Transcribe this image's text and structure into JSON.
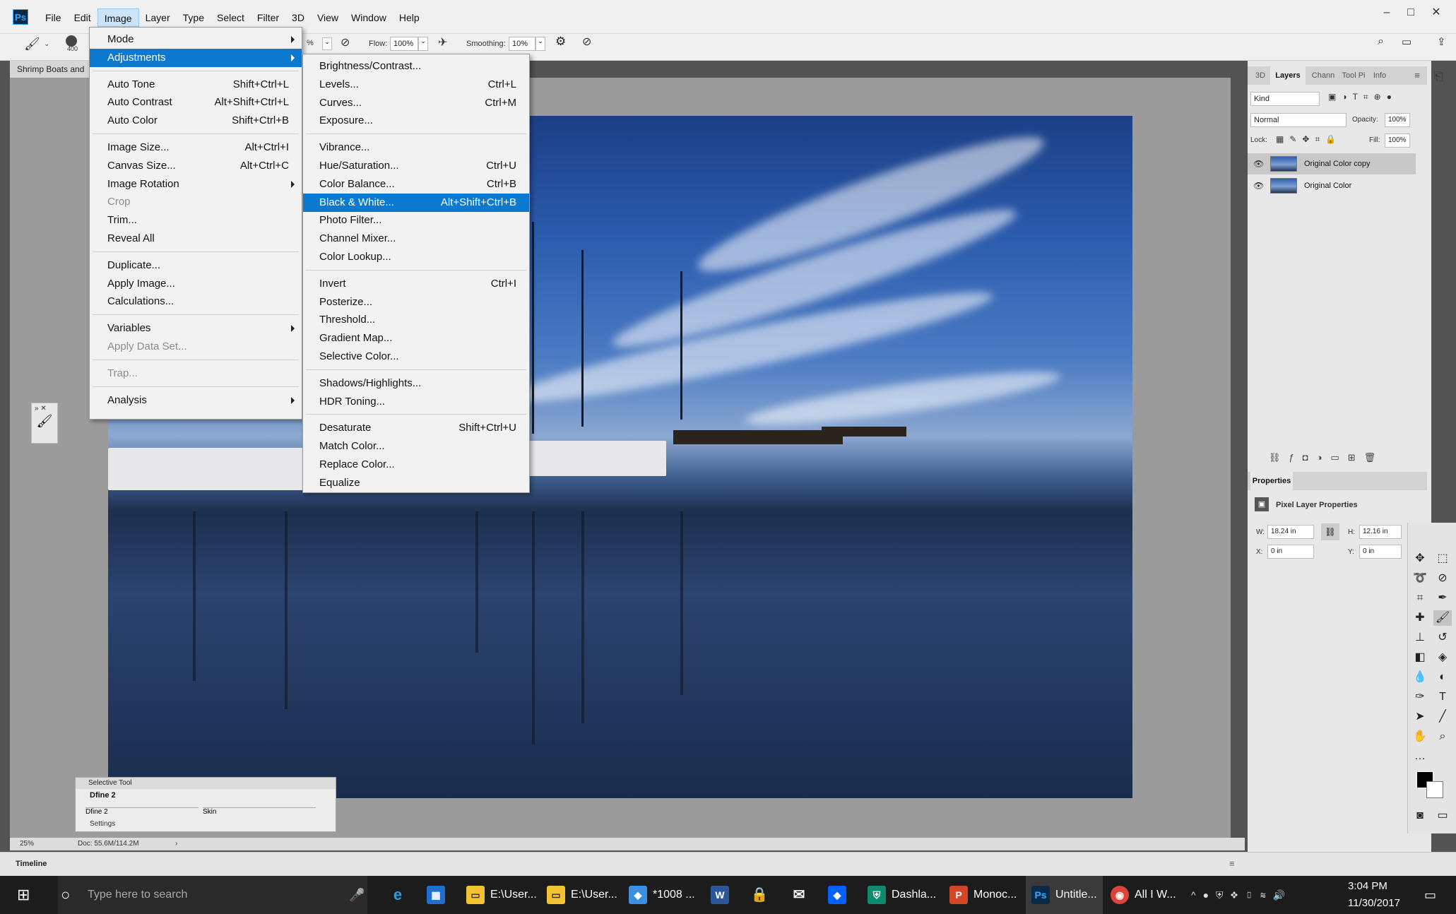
{
  "app": {
    "logo": "Ps"
  },
  "menubar": [
    "File",
    "Edit",
    "Image",
    "Layer",
    "Type",
    "Select",
    "Filter",
    "3D",
    "View",
    "Window",
    "Help"
  ],
  "options": {
    "brush_size": "400",
    "opacity_suffix": "%",
    "flow_label": "Flow:",
    "flow_value": "100%",
    "smoothing_label": "Smoothing:",
    "smoothing_value": "10%"
  },
  "doc_tab": "Shrimp Boats and",
  "image_menu": [
    {
      "label": "Mode",
      "shortcut": "",
      "submenu": true
    },
    {
      "label": "Adjustments",
      "shortcut": "",
      "submenu": true,
      "highlighted": true
    },
    {
      "label": "Auto Tone",
      "shortcut": "Shift+Ctrl+L"
    },
    {
      "label": "Auto Contrast",
      "shortcut": "Alt+Shift+Ctrl+L"
    },
    {
      "label": "Auto Color",
      "shortcut": "Shift+Ctrl+B"
    },
    {
      "label": "Image Size...",
      "shortcut": "Alt+Ctrl+I"
    },
    {
      "label": "Canvas Size...",
      "shortcut": "Alt+Ctrl+C"
    },
    {
      "label": "Image Rotation",
      "shortcut": "",
      "submenu": true
    },
    {
      "label": "Crop",
      "shortcut": "",
      "disabled": true
    },
    {
      "label": "Trim...",
      "shortcut": ""
    },
    {
      "label": "Reveal All",
      "shortcut": ""
    },
    {
      "label": "Duplicate...",
      "shortcut": ""
    },
    {
      "label": "Apply Image...",
      "shortcut": ""
    },
    {
      "label": "Calculations...",
      "shortcut": ""
    },
    {
      "label": "Variables",
      "shortcut": "",
      "submenu": true
    },
    {
      "label": "Apply Data Set...",
      "shortcut": "",
      "disabled": true
    },
    {
      "label": "Trap...",
      "shortcut": "",
      "disabled": true
    },
    {
      "label": "Analysis",
      "shortcut": "",
      "submenu": true
    }
  ],
  "adjustments_menu": [
    {
      "label": "Brightness/Contrast...",
      "shortcut": ""
    },
    {
      "label": "Levels...",
      "shortcut": "Ctrl+L"
    },
    {
      "label": "Curves...",
      "shortcut": "Ctrl+M"
    },
    {
      "label": "Exposure...",
      "shortcut": ""
    },
    {
      "label": "Vibrance...",
      "shortcut": ""
    },
    {
      "label": "Hue/Saturation...",
      "shortcut": "Ctrl+U"
    },
    {
      "label": "Color Balance...",
      "shortcut": "Ctrl+B"
    },
    {
      "label": "Black & White...",
      "shortcut": "Alt+Shift+Ctrl+B",
      "highlighted": true
    },
    {
      "label": "Photo Filter...",
      "shortcut": ""
    },
    {
      "label": "Channel Mixer...",
      "shortcut": ""
    },
    {
      "label": "Color Lookup...",
      "shortcut": ""
    },
    {
      "label": "Invert",
      "shortcut": "Ctrl+I"
    },
    {
      "label": "Posterize...",
      "shortcut": ""
    },
    {
      "label": "Threshold...",
      "shortcut": ""
    },
    {
      "label": "Gradient Map...",
      "shortcut": ""
    },
    {
      "label": "Selective Color...",
      "shortcut": ""
    },
    {
      "label": "Shadows/Highlights...",
      "shortcut": ""
    },
    {
      "label": "HDR Toning...",
      "shortcut": ""
    },
    {
      "label": "Desaturate",
      "shortcut": "Shift+Ctrl+U"
    },
    {
      "label": "Match Color...",
      "shortcut": ""
    },
    {
      "label": "Replace Color...",
      "shortcut": ""
    },
    {
      "label": "Equalize",
      "shortcut": ""
    }
  ],
  "panels": {
    "tabs": [
      "3D",
      "Layers",
      "Chann",
      "Tool Pi",
      "Info"
    ],
    "kind": "Kind",
    "blend_mode": "Normal",
    "opacity_label": "Opacity:",
    "opacity_value": "100%",
    "lock_label": "Lock:",
    "fill_label": "Fill:",
    "fill_value": "100%",
    "layers": [
      "Original Color copy",
      "Original Color"
    ],
    "properties_tab": "Properties",
    "pixel_layer": "Pixel Layer Properties",
    "w_label": "W:",
    "w_value": "18.24 in",
    "h_label": "H:",
    "h_value": "12.16 in",
    "x_label": "X:",
    "x_value": "0 in",
    "y_label": "Y:",
    "y_value": "0 in"
  },
  "selective_tool": {
    "title": "Selective Tool",
    "item": "Dfine 2",
    "col1": "Dfine 2",
    "col2": "Skin",
    "settings": "Settings"
  },
  "status": {
    "zoom": "25%",
    "doc": "Doc: 55.6M/114.2M"
  },
  "timeline": "Timeline",
  "taskbar": {
    "search_placeholder": "Type here to search",
    "items": [
      "E:\\User...",
      "E:\\User...",
      "*1008 ...",
      "Dashla...",
      "Monoc...",
      "Untitle...",
      "All I W..."
    ],
    "time": "3:04 PM",
    "date": "11/30/2017"
  }
}
